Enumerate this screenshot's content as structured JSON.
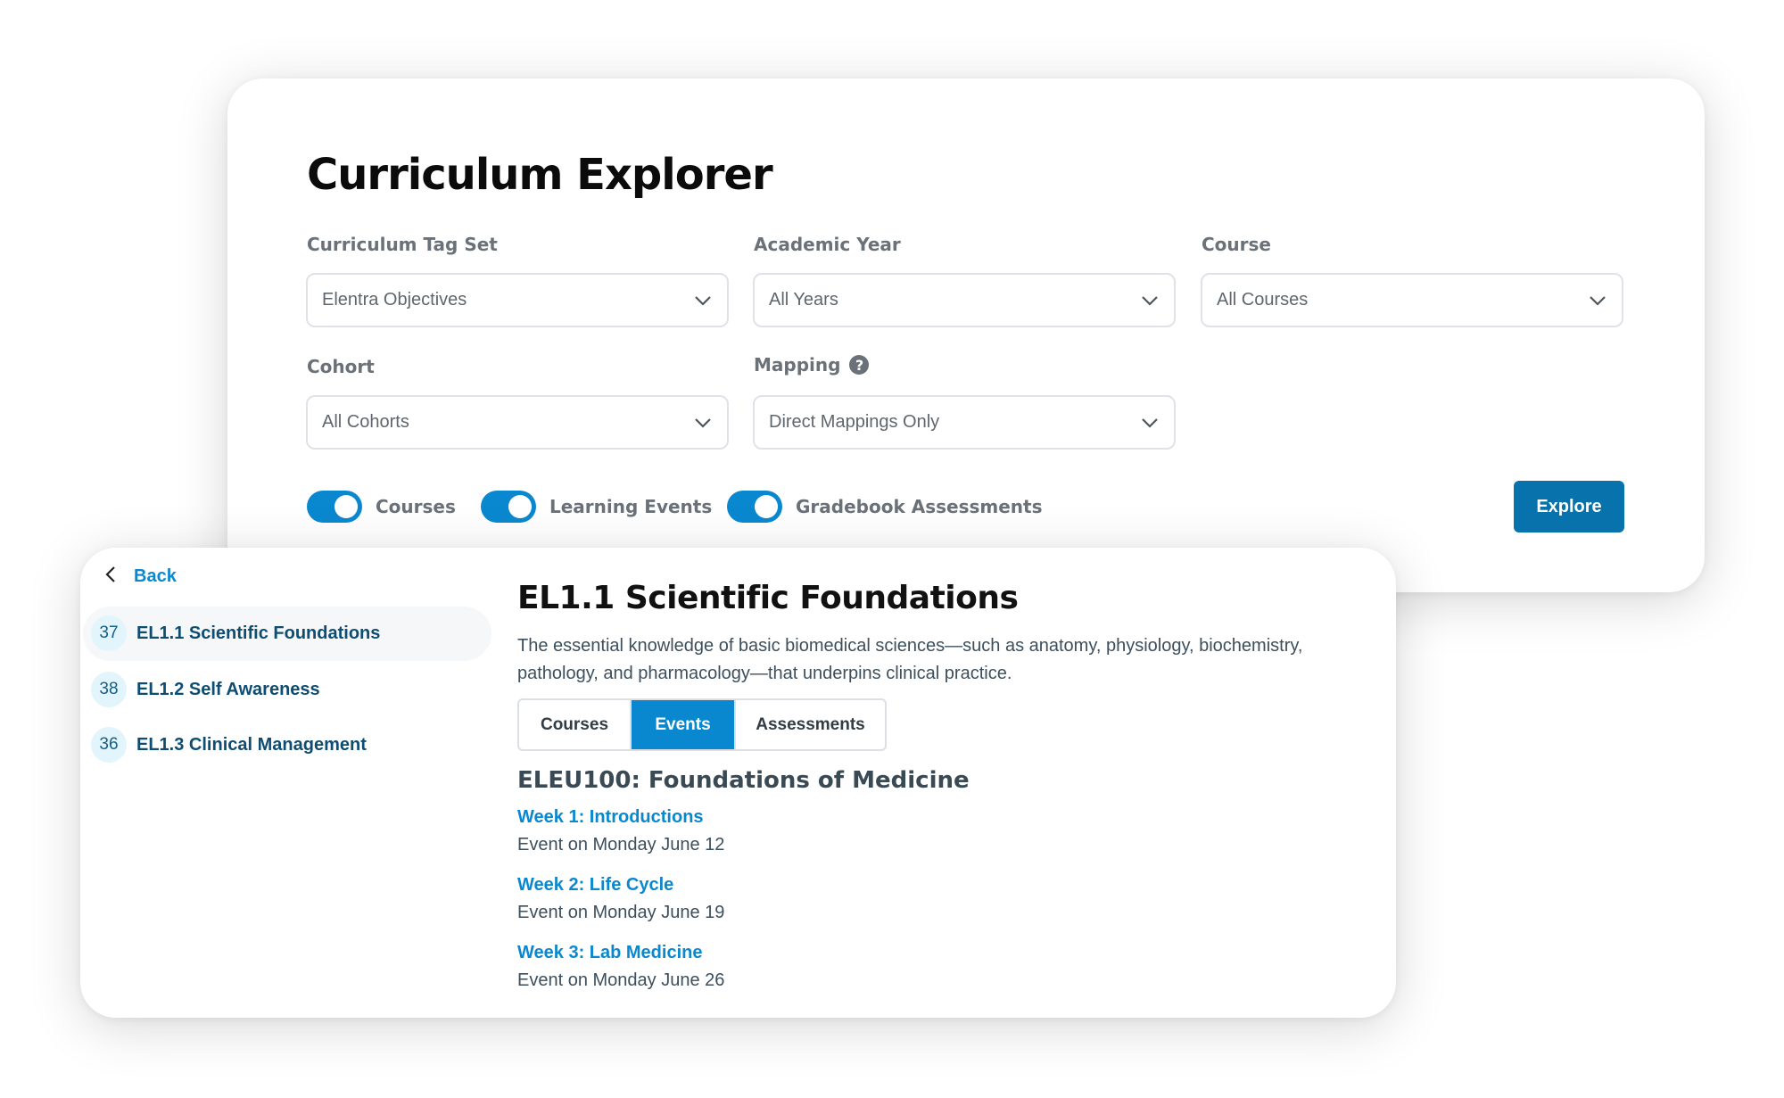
{
  "explorer": {
    "title": "Curriculum Explorer",
    "filters": [
      {
        "label": "Curriculum Tag Set",
        "value": "Elentra Objectives"
      },
      {
        "label": "Academic Year",
        "value": "All Years"
      },
      {
        "label": "Course",
        "value": "All Courses"
      },
      {
        "label": "Cohort",
        "value": "All Cohorts"
      },
      {
        "label": "Mapping",
        "value": "Direct Mappings Only",
        "help_icon": "question-circle-icon"
      }
    ],
    "toggles": [
      {
        "label": "Courses",
        "on": true
      },
      {
        "label": "Learning Events",
        "on": true
      },
      {
        "label": "Gradebook Assessments",
        "on": true
      }
    ],
    "explore_label": "Explore"
  },
  "detail": {
    "back_label": "Back",
    "sidebar": [
      {
        "count": "37",
        "label": "EL1.1 Scientific Foundations",
        "active": true
      },
      {
        "count": "38",
        "label": "EL1.2 Self Awareness",
        "active": false
      },
      {
        "count": "36",
        "label": "EL1.3 Clinical Management",
        "active": false
      }
    ],
    "title": "EL1.1 Scientific Foundations",
    "description": "The essential knowledge of basic biomedical sciences—such as anatomy, physiology, biochemistry, pathology, and pharmacology—that underpins clinical practice.",
    "tabs": [
      {
        "label": "Courses",
        "active": false
      },
      {
        "label": "Events",
        "active": true
      },
      {
        "label": "Assessments",
        "active": false
      }
    ],
    "course_heading": "ELEU100: Foundations of Medicine",
    "events": [
      {
        "title": "Week 1: Introductions",
        "date": "Event on Monday June 12"
      },
      {
        "title": "Week 2: Life Cycle",
        "date": "Event on Monday June 19"
      },
      {
        "title": "Week 3: Lab Medicine",
        "date": "Event on Monday June 26"
      }
    ]
  },
  "colors": {
    "accent": "#0a88cf",
    "button": "#0872ac",
    "navy_text": "#0d4d72",
    "label_gray": "#6b7178"
  }
}
